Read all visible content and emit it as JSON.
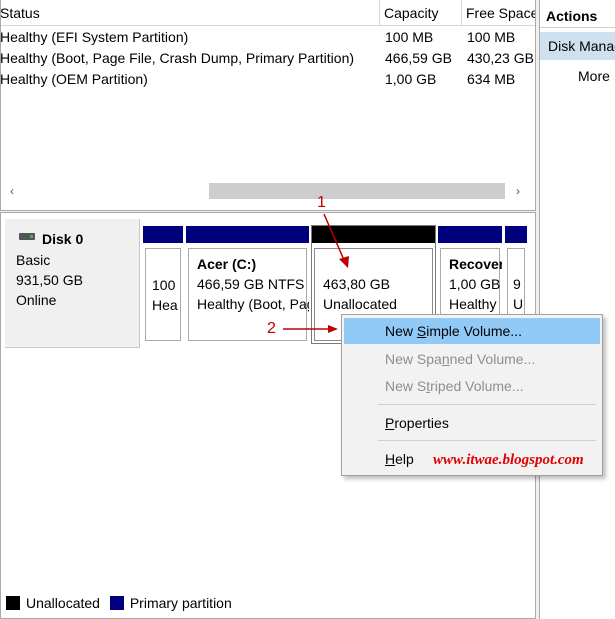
{
  "volume_list": {
    "columns": [
      "Status",
      "Capacity",
      "Free Space"
    ],
    "rows": [
      {
        "status": "Healthy (EFI System Partition)",
        "capacity": "100 MB",
        "free": "100 MB"
      },
      {
        "status": "Healthy (Boot, Page File, Crash Dump, Primary Partition)",
        "capacity": "466,59 GB",
        "free": "430,23 GB"
      },
      {
        "status": "Healthy (OEM Partition)",
        "capacity": "1,00 GB",
        "free": "634 MB"
      }
    ]
  },
  "scrollbar": {
    "left_icon": "‹",
    "right_icon": "›"
  },
  "actions": {
    "title": "Actions",
    "section": "Disk Management",
    "more": "More ..."
  },
  "disk": {
    "name": "Disk 0",
    "type": "Basic",
    "size": "931,50 GB",
    "status": "Online"
  },
  "partitions": [
    {
      "line1": "100",
      "line2": "Hea"
    },
    {
      "title": "Acer  (C:)",
      "line1": "466,59 GB NTFS",
      "line2": "Healthy (Boot, Page File, Crash Dump, Primary Partition)"
    },
    {
      "line1": "463,80 GB",
      "line2": "Unallocated"
    },
    {
      "title": "Recovery",
      "line1": "1,00 GB",
      "line2": "Healthy"
    },
    {
      "line1": "9",
      "line2": "U"
    }
  ],
  "context_menu": {
    "new_simple": {
      "pre": "New ",
      "key": "S",
      "post": "imple Volume..."
    },
    "new_spanned": {
      "pre": "New Spa",
      "key": "n",
      "post": "ned Volume..."
    },
    "new_striped": {
      "pre": "New S",
      "key": "t",
      "post": "riped Volume..."
    },
    "properties": {
      "pre": "",
      "key": "P",
      "post": "roperties"
    },
    "help": {
      "pre": "",
      "key": "H",
      "post": "elp"
    }
  },
  "annotations": {
    "one": "1",
    "two": "2"
  },
  "watermark": "www.itwae.blogspot.com",
  "legend": {
    "unallocated": "Unallocated",
    "primary": "Primary partition"
  },
  "colors": {
    "primary": "#00007f",
    "unallocated": "#000000",
    "highlight": "#91c9f7",
    "annotation": "#c00000"
  }
}
